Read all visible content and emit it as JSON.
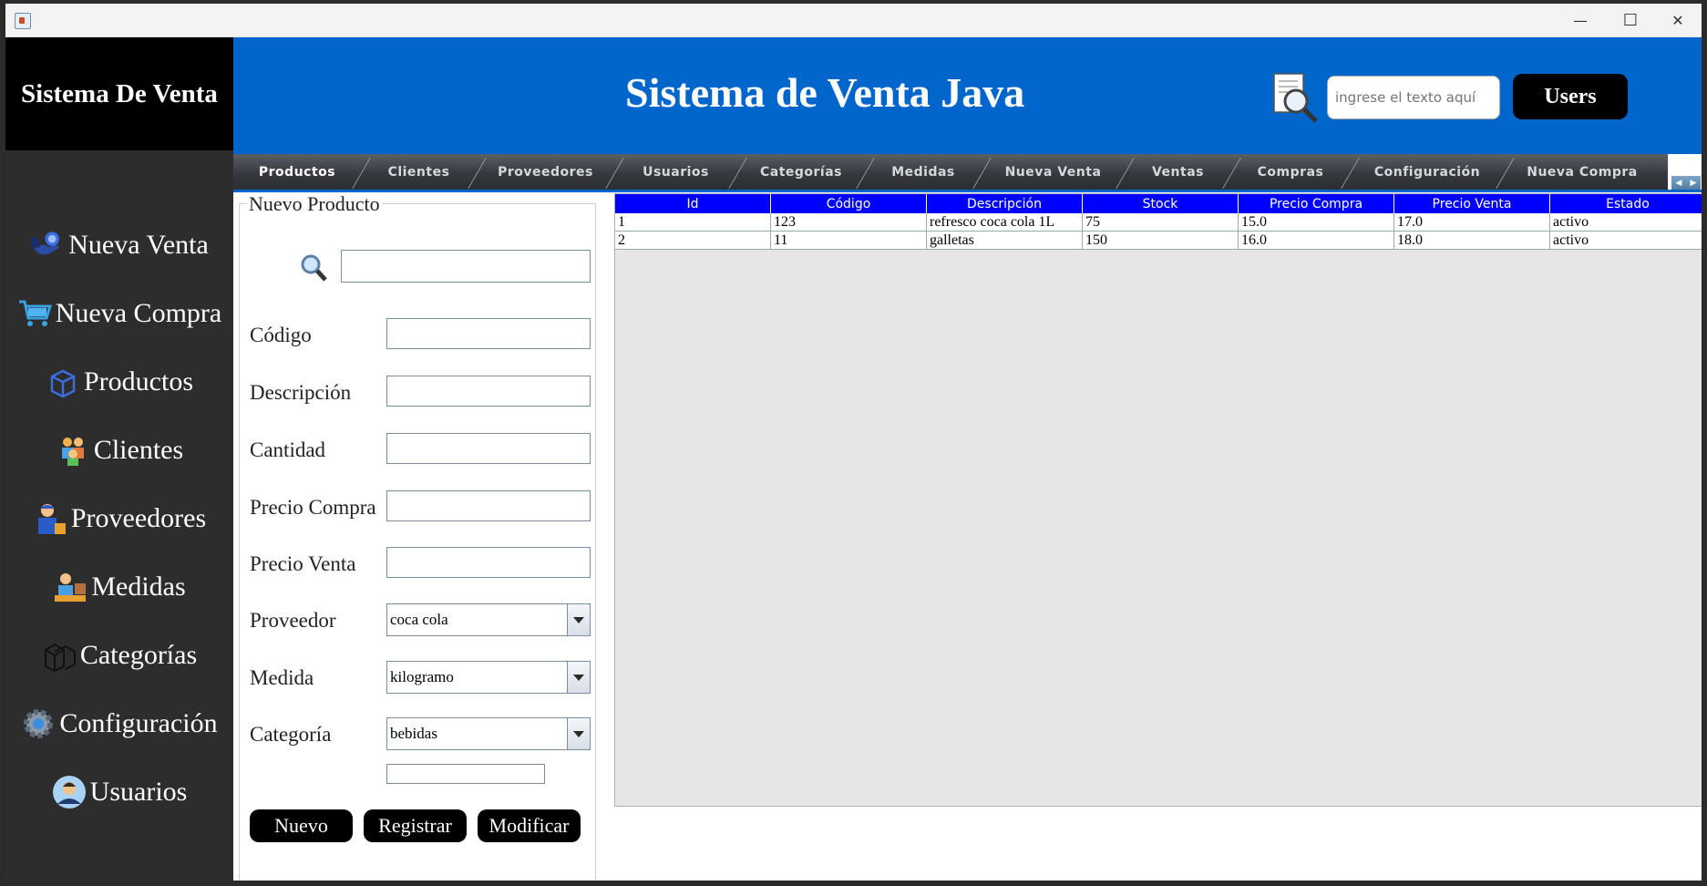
{
  "window": {
    "minimize_glyph": "—",
    "maximize_glyph": "☐",
    "close_glyph": "✕",
    "icon": "java-app-icon"
  },
  "sidebar": {
    "brand": "Sistema De Venta",
    "items": [
      {
        "label": "Nueva Venta",
        "icon": "hand-coin-icon"
      },
      {
        "label": "Nueva Compra",
        "icon": "cart-icon"
      },
      {
        "label": "Productos",
        "icon": "box-icon"
      },
      {
        "label": "Clientes",
        "icon": "clients-icon"
      },
      {
        "label": "Proveedores",
        "icon": "delivery-person-icon"
      },
      {
        "label": "Medidas",
        "icon": "measure-icon"
      },
      {
        "label": "Categorías",
        "icon": "boxes-icon"
      },
      {
        "label": "Configuración",
        "icon": "gear-icon"
      },
      {
        "label": "Usuarios",
        "icon": "user-icon"
      }
    ]
  },
  "header": {
    "title": "Sistema de Venta Java",
    "search_placeholder": "ingrese el texto aquí",
    "users_button": "Users",
    "search_icon": "document-search-icon"
  },
  "tabs": [
    "Productos",
    "Clientes",
    "Proveedores",
    "Usuarios",
    "Categorías",
    "Medidas",
    "Nueva Venta",
    "Ventas",
    "Compras",
    "Configuración",
    "Nueva Compra"
  ],
  "active_tab": "Productos",
  "form": {
    "legend": "Nuevo Producto",
    "search_value": "",
    "codigo_label": "Código",
    "descripcion_label": "Descripción",
    "cantidad_label": "Cantidad",
    "precio_compra_label": "Precio Compra",
    "precio_venta_label": "Precio Venta",
    "proveedor_label": "Proveedor",
    "proveedor_value": "coca cola",
    "medida_label": "Medida",
    "medida_value": "kilogramo",
    "categoria_label": "Categoría",
    "categoria_value": "bebidas",
    "nuevo_button": "Nuevo",
    "registrar_button": "Registrar",
    "modificar_button": "Modificar"
  },
  "table": {
    "columns": [
      "Id",
      "Código",
      "Descripción",
      "Stock",
      "Precio Compra",
      "Precio Venta",
      "Estado"
    ],
    "rows": [
      [
        "1",
        "123",
        "refresco coca cola 1L",
        "75",
        "15.0",
        "17.0",
        "activo"
      ],
      [
        "2",
        "11",
        "galletas",
        "150",
        "16.0",
        "18.0",
        "activo"
      ]
    ]
  },
  "colors": {
    "header_blue": "#0066cc",
    "table_header": "#0000ff",
    "sidebar_bg": "#2d2d2d"
  }
}
